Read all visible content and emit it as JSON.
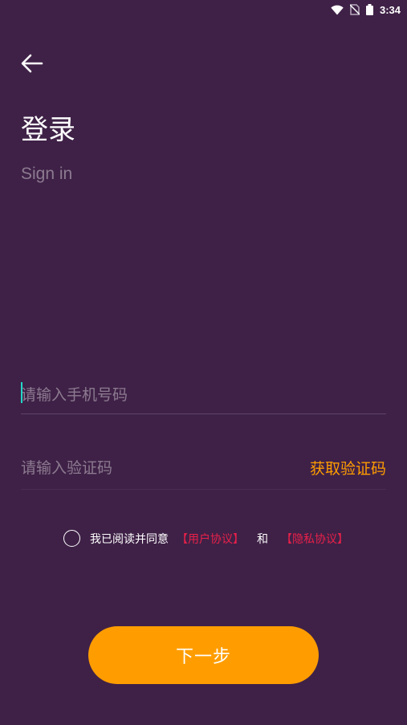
{
  "status_bar": {
    "time": "3:34",
    "icons": [
      "wifi-icon",
      "no-sim-icon",
      "battery-icon"
    ]
  },
  "header": {
    "back_icon": "arrow-left-icon",
    "title": "登录",
    "subtitle": "Sign in"
  },
  "form": {
    "phone_placeholder": "请输入手机号码",
    "code_placeholder": "请输入验证码",
    "get_code_label": "获取验证码"
  },
  "agreement": {
    "text": "我已阅读并同意",
    "user_agreement": "【用户协议】",
    "and": "和",
    "privacy_policy": "【隐私协议】",
    "checked": false
  },
  "actions": {
    "next_label": "下一步"
  },
  "colors": {
    "background": "#3f2147",
    "accent": "#ff9d00",
    "link": "#e8204a",
    "caret": "#22d8c8"
  }
}
